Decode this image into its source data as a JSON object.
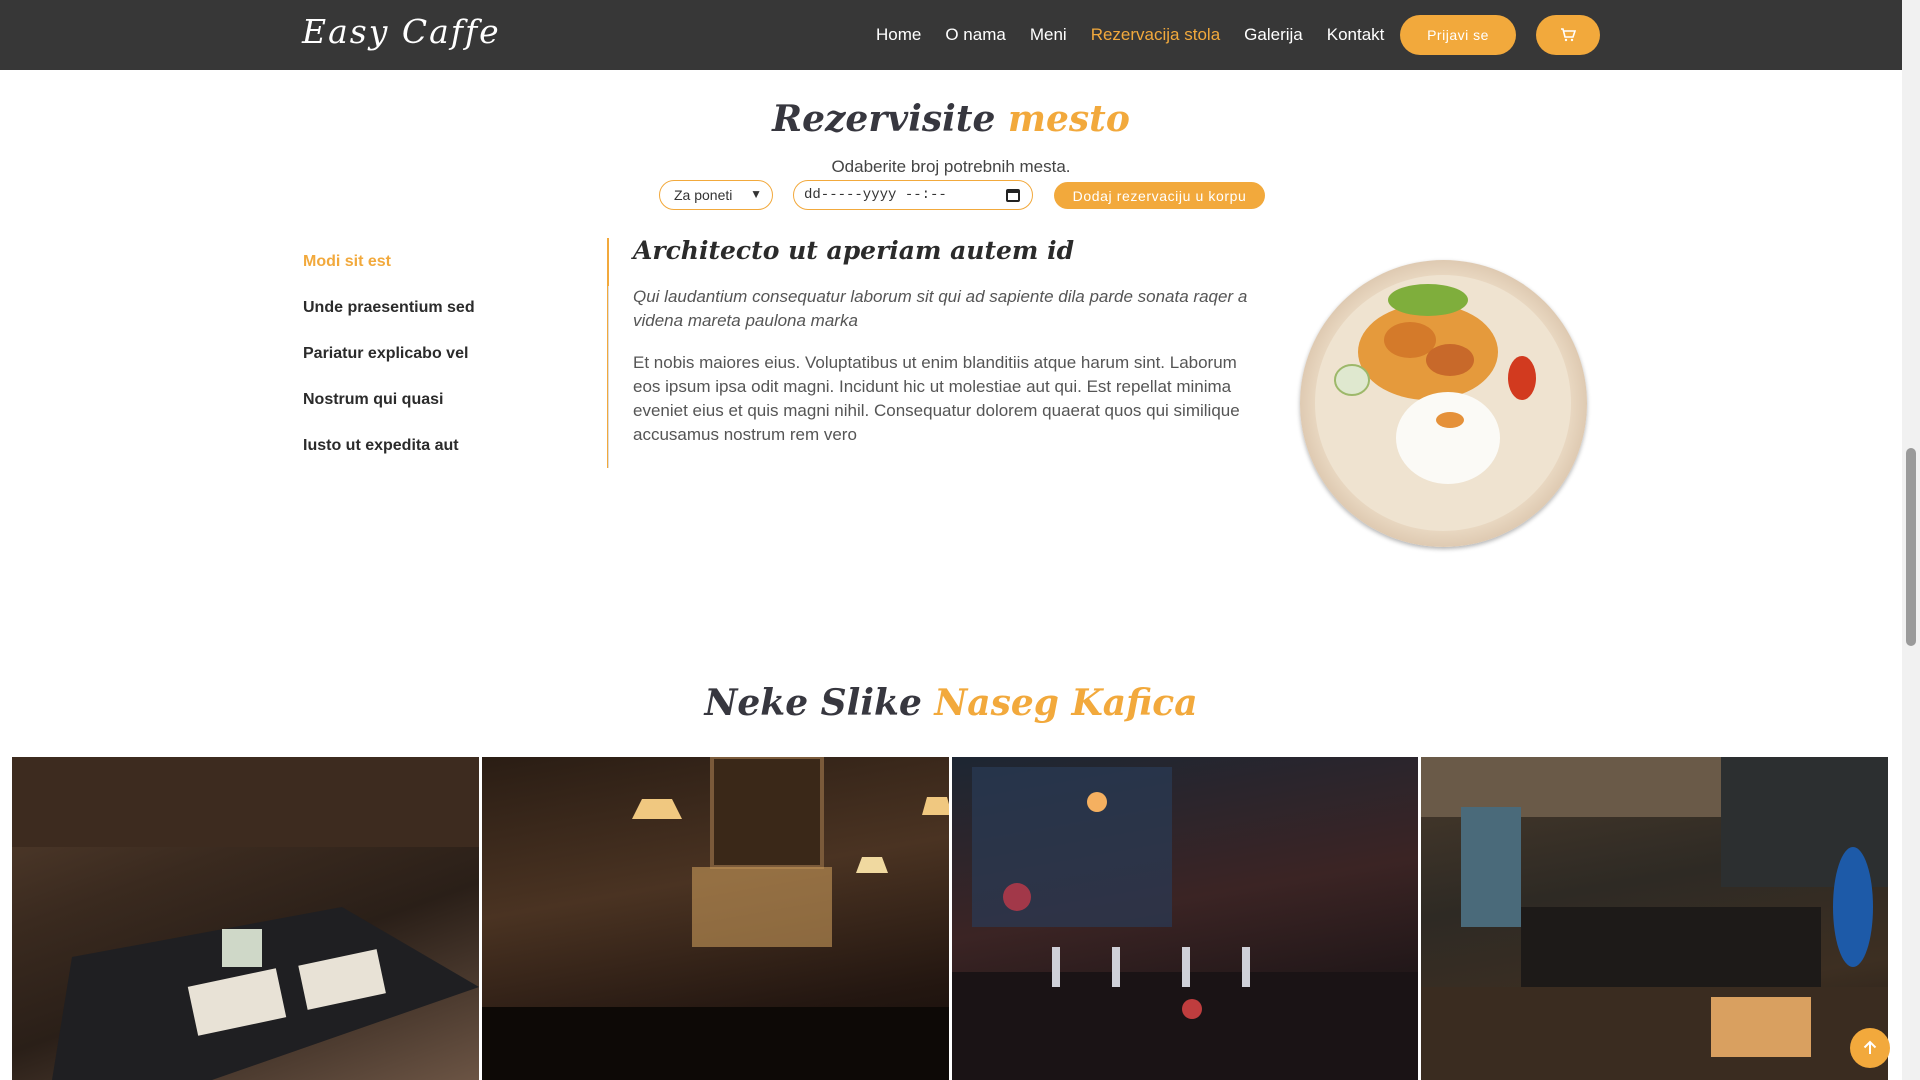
{
  "header": {
    "logo": "Easy Caffe",
    "nav": [
      "Home",
      "O nama",
      "Meni",
      "Rezervacija stola",
      "Galerija",
      "Kontakt"
    ],
    "active_nav": "Rezervacija stola",
    "login_label": "Prijavi se",
    "cart_icon": "cart-icon"
  },
  "reservation": {
    "title_main": "Rezervisite",
    "title_accent": "mesto",
    "subtitle": "Odaberite broj potrebnih mesta.",
    "select_value": "Za poneti",
    "date_placeholder": "dd-----yyyy --:--",
    "add_button": "Dodaj rezervaciju u korpu"
  },
  "tabs": {
    "items": [
      "Modi sit est",
      "Unde praesentium sed",
      "Pariatur explicabo vel",
      "Nostrum qui quasi",
      "Iusto ut expedita aut"
    ],
    "active_index": 0
  },
  "content": {
    "heading": "Architecto ut aperiam autem id",
    "italic": "Qui laudantium consequatur laborum sit qui ad sapiente dila parde sonata raqer a videna mareta paulona marka",
    "body": "Et nobis maiores eius. Voluptatibus ut enim blanditiis atque harum sint. Laborum eos ipsum ipsa odit magni. Incidunt hic ut molestiae aut qui. Est repellat minima eveniet eius et quis magni nihil. Consequatur dolorem quaerat quos qui similique accusamus nostrum rem vero"
  },
  "gallery": {
    "title_main": "Neke Slike",
    "title_accent": "Naseg Kafica"
  },
  "colors": {
    "accent": "#f2a93c",
    "header_bg": "#373737"
  }
}
